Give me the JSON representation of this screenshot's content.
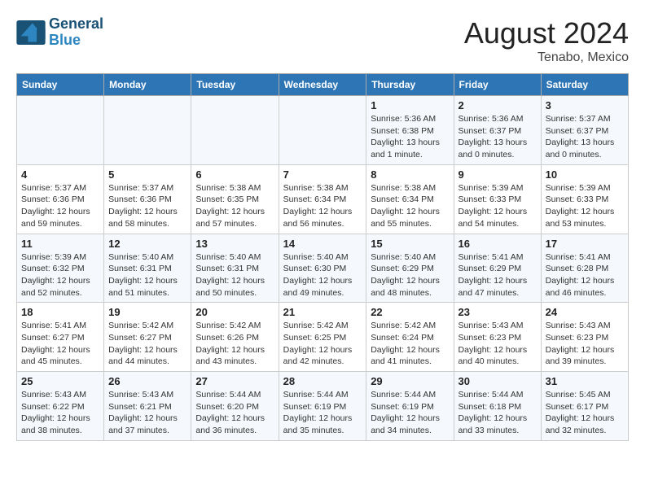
{
  "header": {
    "logo_line1": "General",
    "logo_line2": "Blue",
    "month_year": "August 2024",
    "location": "Tenabo, Mexico"
  },
  "days_of_week": [
    "Sunday",
    "Monday",
    "Tuesday",
    "Wednesday",
    "Thursday",
    "Friday",
    "Saturday"
  ],
  "weeks": [
    [
      {
        "day": "",
        "info": ""
      },
      {
        "day": "",
        "info": ""
      },
      {
        "day": "",
        "info": ""
      },
      {
        "day": "",
        "info": ""
      },
      {
        "day": "1",
        "info": "Sunrise: 5:36 AM\nSunset: 6:38 PM\nDaylight: 13 hours and 1 minute."
      },
      {
        "day": "2",
        "info": "Sunrise: 5:36 AM\nSunset: 6:37 PM\nDaylight: 13 hours and 0 minutes."
      },
      {
        "day": "3",
        "info": "Sunrise: 5:37 AM\nSunset: 6:37 PM\nDaylight: 13 hours and 0 minutes."
      }
    ],
    [
      {
        "day": "4",
        "info": "Sunrise: 5:37 AM\nSunset: 6:36 PM\nDaylight: 12 hours and 59 minutes."
      },
      {
        "day": "5",
        "info": "Sunrise: 5:37 AM\nSunset: 6:36 PM\nDaylight: 12 hours and 58 minutes."
      },
      {
        "day": "6",
        "info": "Sunrise: 5:38 AM\nSunset: 6:35 PM\nDaylight: 12 hours and 57 minutes."
      },
      {
        "day": "7",
        "info": "Sunrise: 5:38 AM\nSunset: 6:34 PM\nDaylight: 12 hours and 56 minutes."
      },
      {
        "day": "8",
        "info": "Sunrise: 5:38 AM\nSunset: 6:34 PM\nDaylight: 12 hours and 55 minutes."
      },
      {
        "day": "9",
        "info": "Sunrise: 5:39 AM\nSunset: 6:33 PM\nDaylight: 12 hours and 54 minutes."
      },
      {
        "day": "10",
        "info": "Sunrise: 5:39 AM\nSunset: 6:33 PM\nDaylight: 12 hours and 53 minutes."
      }
    ],
    [
      {
        "day": "11",
        "info": "Sunrise: 5:39 AM\nSunset: 6:32 PM\nDaylight: 12 hours and 52 minutes."
      },
      {
        "day": "12",
        "info": "Sunrise: 5:40 AM\nSunset: 6:31 PM\nDaylight: 12 hours and 51 minutes."
      },
      {
        "day": "13",
        "info": "Sunrise: 5:40 AM\nSunset: 6:31 PM\nDaylight: 12 hours and 50 minutes."
      },
      {
        "day": "14",
        "info": "Sunrise: 5:40 AM\nSunset: 6:30 PM\nDaylight: 12 hours and 49 minutes."
      },
      {
        "day": "15",
        "info": "Sunrise: 5:40 AM\nSunset: 6:29 PM\nDaylight: 12 hours and 48 minutes."
      },
      {
        "day": "16",
        "info": "Sunrise: 5:41 AM\nSunset: 6:29 PM\nDaylight: 12 hours and 47 minutes."
      },
      {
        "day": "17",
        "info": "Sunrise: 5:41 AM\nSunset: 6:28 PM\nDaylight: 12 hours and 46 minutes."
      }
    ],
    [
      {
        "day": "18",
        "info": "Sunrise: 5:41 AM\nSunset: 6:27 PM\nDaylight: 12 hours and 45 minutes."
      },
      {
        "day": "19",
        "info": "Sunrise: 5:42 AM\nSunset: 6:27 PM\nDaylight: 12 hours and 44 minutes."
      },
      {
        "day": "20",
        "info": "Sunrise: 5:42 AM\nSunset: 6:26 PM\nDaylight: 12 hours and 43 minutes."
      },
      {
        "day": "21",
        "info": "Sunrise: 5:42 AM\nSunset: 6:25 PM\nDaylight: 12 hours and 42 minutes."
      },
      {
        "day": "22",
        "info": "Sunrise: 5:42 AM\nSunset: 6:24 PM\nDaylight: 12 hours and 41 minutes."
      },
      {
        "day": "23",
        "info": "Sunrise: 5:43 AM\nSunset: 6:23 PM\nDaylight: 12 hours and 40 minutes."
      },
      {
        "day": "24",
        "info": "Sunrise: 5:43 AM\nSunset: 6:23 PM\nDaylight: 12 hours and 39 minutes."
      }
    ],
    [
      {
        "day": "25",
        "info": "Sunrise: 5:43 AM\nSunset: 6:22 PM\nDaylight: 12 hours and 38 minutes."
      },
      {
        "day": "26",
        "info": "Sunrise: 5:43 AM\nSunset: 6:21 PM\nDaylight: 12 hours and 37 minutes."
      },
      {
        "day": "27",
        "info": "Sunrise: 5:44 AM\nSunset: 6:20 PM\nDaylight: 12 hours and 36 minutes."
      },
      {
        "day": "28",
        "info": "Sunrise: 5:44 AM\nSunset: 6:19 PM\nDaylight: 12 hours and 35 minutes."
      },
      {
        "day": "29",
        "info": "Sunrise: 5:44 AM\nSunset: 6:19 PM\nDaylight: 12 hours and 34 minutes."
      },
      {
        "day": "30",
        "info": "Sunrise: 5:44 AM\nSunset: 6:18 PM\nDaylight: 12 hours and 33 minutes."
      },
      {
        "day": "31",
        "info": "Sunrise: 5:45 AM\nSunset: 6:17 PM\nDaylight: 12 hours and 32 minutes."
      }
    ]
  ]
}
